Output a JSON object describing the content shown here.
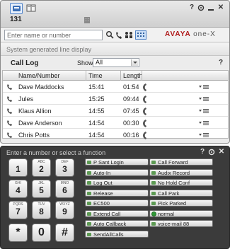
{
  "titlebar": {
    "extension": "131",
    "tabs": [
      "phone-tab",
      "contacts-tab"
    ]
  },
  "search": {
    "placeholder": "Enter name or number",
    "brand_avaya": "AVAYA",
    "brand_onex": "one-X"
  },
  "line_display": "System generated line display",
  "call_log": {
    "title": "Call Log",
    "show_label": "Show:",
    "show_value": "All",
    "help": "?",
    "columns": [
      "Name/Number",
      "Time",
      "Length"
    ],
    "rows": [
      {
        "name": "Dave Maddocks",
        "time": "15:41",
        "length": "01:54"
      },
      {
        "name": "Jules",
        "time": "15:25",
        "length": "09:44"
      },
      {
        "name": "Klaus Allion",
        "time": "14:55",
        "length": "07:45"
      },
      {
        "name": "Dave Anderson",
        "time": "14:54",
        "length": "00:30"
      },
      {
        "name": "Chris Potts",
        "time": "14:54",
        "length": "00:16"
      }
    ]
  },
  "dial": {
    "prompt": "Enter a number or select a function",
    "keys": [
      {
        "num": "1",
        "sub": ""
      },
      {
        "num": "2",
        "sub": "ABC"
      },
      {
        "num": "3",
        "sub": "DEF"
      },
      {
        "num": "4",
        "sub": "GHI"
      },
      {
        "num": "5",
        "sub": "JKL"
      },
      {
        "num": "6",
        "sub": "MNO"
      },
      {
        "num": "7",
        "sub": "PQRS"
      },
      {
        "num": "8",
        "sub": "TUV"
      },
      {
        "num": "9",
        "sub": "WXYZ"
      },
      {
        "num": "*",
        "sub": ""
      },
      {
        "num": "0",
        "sub": ""
      },
      {
        "num": "#",
        "sub": ""
      }
    ],
    "functions_left": [
      "P Sant Login",
      "Auto-In",
      "Log Out",
      "Release",
      "EC500",
      "Extend Call",
      "Auto Callback",
      "SendAllCalls"
    ],
    "functions_right": [
      "Call Forward",
      "Audix Record",
      "No Hold Conf",
      "Call Park",
      "Pick Parked",
      "normal",
      "voice-mail 88"
    ]
  },
  "colors": {
    "brand_red": "#b01c1c",
    "dark_panel": "#3b3b3b",
    "status_green": "#2f9a37"
  }
}
